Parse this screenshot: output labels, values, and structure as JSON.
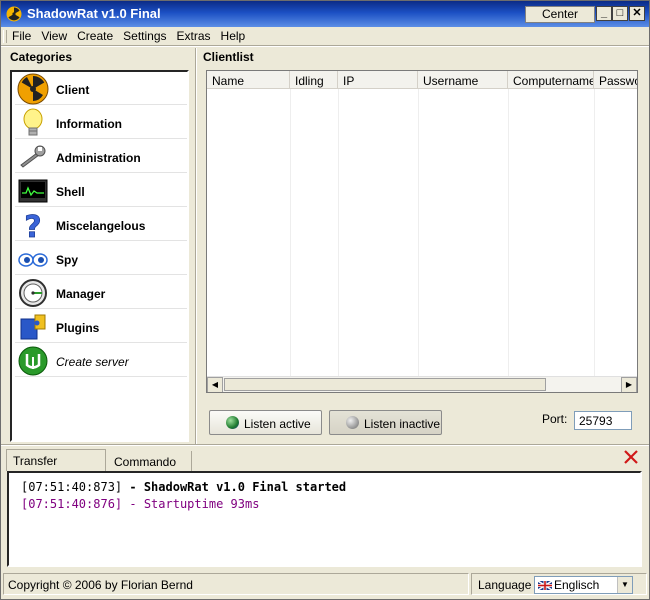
{
  "window": {
    "title": "ShadowRat v1.0 Final",
    "center_label": "Center",
    "min_glyph": "_",
    "max_glyph": "□",
    "close_glyph": "✕"
  },
  "menu": [
    "File",
    "View",
    "Create",
    "Settings",
    "Extras",
    "Help"
  ],
  "categories": {
    "title": "Categories",
    "items": [
      {
        "label": "Client",
        "icon": "radiation-icon",
        "style": "bold"
      },
      {
        "label": "Information",
        "icon": "lightbulb-icon",
        "style": "bold"
      },
      {
        "label": "Administration",
        "icon": "wrench-icon",
        "style": "bold"
      },
      {
        "label": "Shell",
        "icon": "terminal-icon",
        "style": "bold"
      },
      {
        "label": "Miscelangelous",
        "icon": "question-icon",
        "style": "bold"
      },
      {
        "label": "Spy",
        "icon": "eyes-icon",
        "style": "bold"
      },
      {
        "label": "Manager",
        "icon": "gauge-icon",
        "style": "bold"
      },
      {
        "label": "Plugins",
        "icon": "puzzle-icon",
        "style": "bold"
      },
      {
        "label": "Create server",
        "icon": "create-server-icon",
        "style": "italic"
      }
    ]
  },
  "clientlist": {
    "title": "Clientlist",
    "columns": [
      "Name",
      "Idling",
      "IP",
      "Username",
      "Computername",
      "Passwo"
    ]
  },
  "listen": {
    "active_label": "Listen active",
    "inactive_label": "Listen inactive",
    "port_label": "Port:",
    "port_value": "25793"
  },
  "tabs": {
    "transfer": "Transfer manager",
    "commando": "Commando log"
  },
  "log": [
    {
      "time": "[07:51:40:873]",
      "text": " - ShadowRat v1.0 Final started",
      "color": "#000000"
    },
    {
      "time": "[07:51:40:876]",
      "text": " - Startuptime 93ms",
      "color": "#800080"
    }
  ],
  "status": {
    "copyright": "Copyright © 2006 by Florian Bernd",
    "language_label": "Language",
    "language_value": "Englisch"
  }
}
